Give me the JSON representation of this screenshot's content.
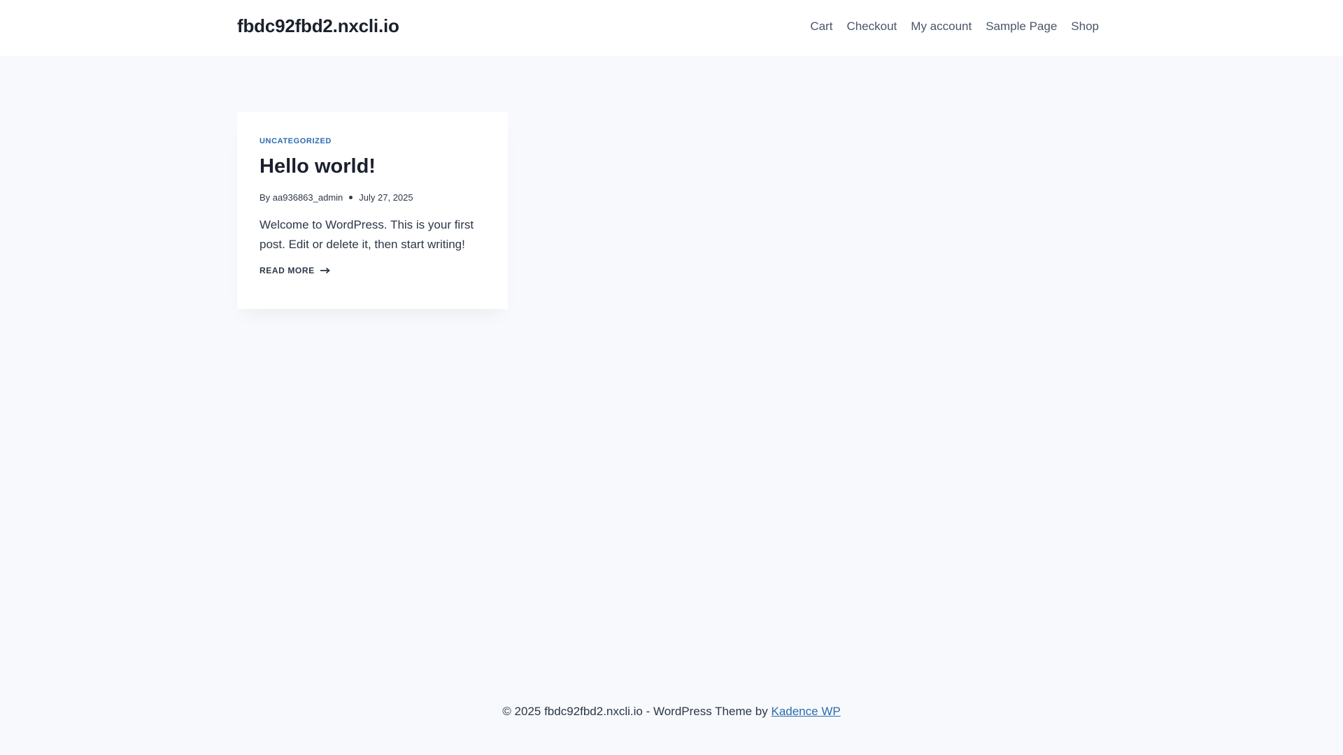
{
  "header": {
    "site_title": "fbdc92fbd2.nxcli.io",
    "nav": [
      {
        "label": "Cart"
      },
      {
        "label": "Checkout"
      },
      {
        "label": "My account"
      },
      {
        "label": "Sample Page"
      },
      {
        "label": "Shop"
      }
    ]
  },
  "post": {
    "category": "UNCATEGORIZED",
    "title": "Hello world!",
    "author_prefix": "By",
    "author": "aa936863_admin",
    "date": "July 27, 2025",
    "excerpt": "Welcome to WordPress. This is your first post. Edit or delete it, then start writing!",
    "read_more": "READ MORE",
    "read_more_icon": "arrow-right-icon"
  },
  "footer": {
    "text": "© 2025 fbdc92fbd2.nxcli.io - WordPress Theme by ",
    "link_label": "Kadence WP"
  },
  "colors": {
    "background": "#f7f9fc",
    "accent": "#2b6cb0",
    "heading": "#1a202c"
  }
}
